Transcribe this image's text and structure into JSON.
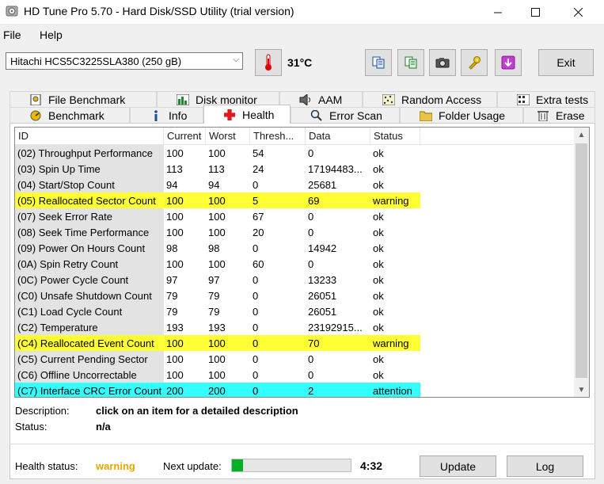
{
  "window": {
    "title": "HD Tune Pro 5.70 - Hard Disk/SSD Utility (trial version)"
  },
  "menu": {
    "file": "File",
    "help": "Help"
  },
  "toolbar": {
    "drive": "Hitachi HCS5C3225SLA380 (250 gB)",
    "temperature": "31°C",
    "exit_label": "Exit"
  },
  "tabs_row1": [
    "File Benchmark",
    "Disk monitor",
    "AAM",
    "Random Access",
    "Extra tests"
  ],
  "tabs_row2": [
    "Benchmark",
    "Info",
    "Health",
    "Error Scan",
    "Folder Usage",
    "Erase"
  ],
  "active_tab": "Health",
  "table": {
    "headers": [
      "ID",
      "Current",
      "Worst",
      "Thresh...",
      "Data",
      "Status"
    ],
    "rows": [
      {
        "id": "(02) Throughput Performance",
        "current": "100",
        "worst": "100",
        "threshold": "54",
        "data": "0",
        "status": "ok",
        "level": "ok"
      },
      {
        "id": "(03) Spin Up Time",
        "current": "113",
        "worst": "113",
        "threshold": "24",
        "data": "17194483...",
        "status": "ok",
        "level": "ok"
      },
      {
        "id": "(04) Start/Stop Count",
        "current": "94",
        "worst": "94",
        "threshold": "0",
        "data": "25681",
        "status": "ok",
        "level": "ok"
      },
      {
        "id": "(05) Reallocated Sector Count",
        "current": "100",
        "worst": "100",
        "threshold": "5",
        "data": "69",
        "status": "warning",
        "level": "warning"
      },
      {
        "id": "(07) Seek Error Rate",
        "current": "100",
        "worst": "100",
        "threshold": "67",
        "data": "0",
        "status": "ok",
        "level": "ok"
      },
      {
        "id": "(08) Seek Time Performance",
        "current": "100",
        "worst": "100",
        "threshold": "20",
        "data": "0",
        "status": "ok",
        "level": "ok"
      },
      {
        "id": "(09) Power On Hours Count",
        "current": "98",
        "worst": "98",
        "threshold": "0",
        "data": "14942",
        "status": "ok",
        "level": "ok"
      },
      {
        "id": "(0A) Spin Retry Count",
        "current": "100",
        "worst": "100",
        "threshold": "60",
        "data": "0",
        "status": "ok",
        "level": "ok"
      },
      {
        "id": "(0C) Power Cycle Count",
        "current": "97",
        "worst": "97",
        "threshold": "0",
        "data": "13233",
        "status": "ok",
        "level": "ok"
      },
      {
        "id": "(C0) Unsafe Shutdown Count",
        "current": "79",
        "worst": "79",
        "threshold": "0",
        "data": "26051",
        "status": "ok",
        "level": "ok"
      },
      {
        "id": "(C1) Load Cycle Count",
        "current": "79",
        "worst": "79",
        "threshold": "0",
        "data": "26051",
        "status": "ok",
        "level": "ok"
      },
      {
        "id": "(C2) Temperature",
        "current": "193",
        "worst": "193",
        "threshold": "0",
        "data": "23192915...",
        "status": "ok",
        "level": "ok"
      },
      {
        "id": "(C4) Reallocated Event Count",
        "current": "100",
        "worst": "100",
        "threshold": "0",
        "data": "70",
        "status": "warning",
        "level": "warning"
      },
      {
        "id": "(C5) Current Pending Sector",
        "current": "100",
        "worst": "100",
        "threshold": "0",
        "data": "0",
        "status": "ok",
        "level": "ok"
      },
      {
        "id": "(C6) Offline Uncorrectable",
        "current": "100",
        "worst": "100",
        "threshold": "0",
        "data": "0",
        "status": "ok",
        "level": "ok"
      },
      {
        "id": "(C7) Interface CRC Error Count",
        "current": "200",
        "worst": "200",
        "threshold": "0",
        "data": "2",
        "status": "attention",
        "level": "attention"
      }
    ]
  },
  "description": {
    "label": "Description:",
    "value": "click on an item for a detailed description",
    "status_label": "Status:",
    "status_value": "n/a"
  },
  "footer": {
    "health_label": "Health status:",
    "health_value": "warning",
    "next_update_label": "Next update:",
    "next_update_progress": 0.09,
    "next_update_time": "4:32",
    "update_button": "Update",
    "log_button": "Log"
  },
  "colors": {
    "warning_row": "#ffff33",
    "attention_row": "#33ffff",
    "health_warning_text": "#e6a800",
    "progress_fill": "#06b025"
  }
}
